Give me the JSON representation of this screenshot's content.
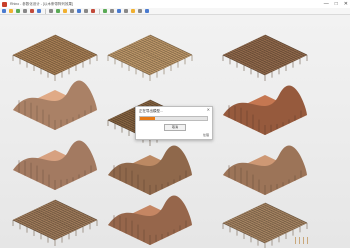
{
  "window": {
    "title": "Rhino - 参数化设计 - [以木条带阵列效果]",
    "minimize": "—",
    "maximize": "□",
    "close": "✕"
  },
  "toolbar": {
    "colors": [
      "#4a7bd0",
      "#f0b030",
      "#5aaa55",
      "#888888",
      "#c24a3a",
      "#4a7bd0",
      "#888888",
      "#5aaa55",
      "#f0b030",
      "#888888",
      "#4a7bd0",
      "#888888",
      "#c24a3a",
      "#5aaa55",
      "#888888",
      "#4a7bd0",
      "#888888",
      "#f0b030",
      "#888888",
      "#4a7bd0"
    ]
  },
  "dialog": {
    "title": "正在导出模型...",
    "close": "✕",
    "progress": 0.22,
    "button_label": "取消",
    "status": "",
    "percent": "处理"
  },
  "thumbnails": [
    {
      "type": "slats-grid",
      "tone": "#b2875a"
    },
    {
      "type": "slats-grid",
      "tone": "#c8a070"
    },
    {
      "type": "slats-grid",
      "tone": "#9a7050"
    },
    {
      "type": "wave-surface",
      "tone": "#c89878"
    },
    {
      "type": "slats-grid",
      "tone": "#8f6a46"
    },
    {
      "type": "wave-surface",
      "tone": "#b06a48"
    },
    {
      "type": "wave-surface",
      "tone": "#c09072"
    },
    {
      "type": "wave-surface",
      "tone": "#a87a58"
    },
    {
      "type": "wave-surface",
      "tone": "#b88868"
    },
    {
      "type": "slats-grid",
      "tone": "#a88260"
    },
    {
      "type": "wave-surface",
      "tone": "#b07858"
    },
    {
      "type": "slats-grid",
      "tone": "#b08c68"
    }
  ]
}
